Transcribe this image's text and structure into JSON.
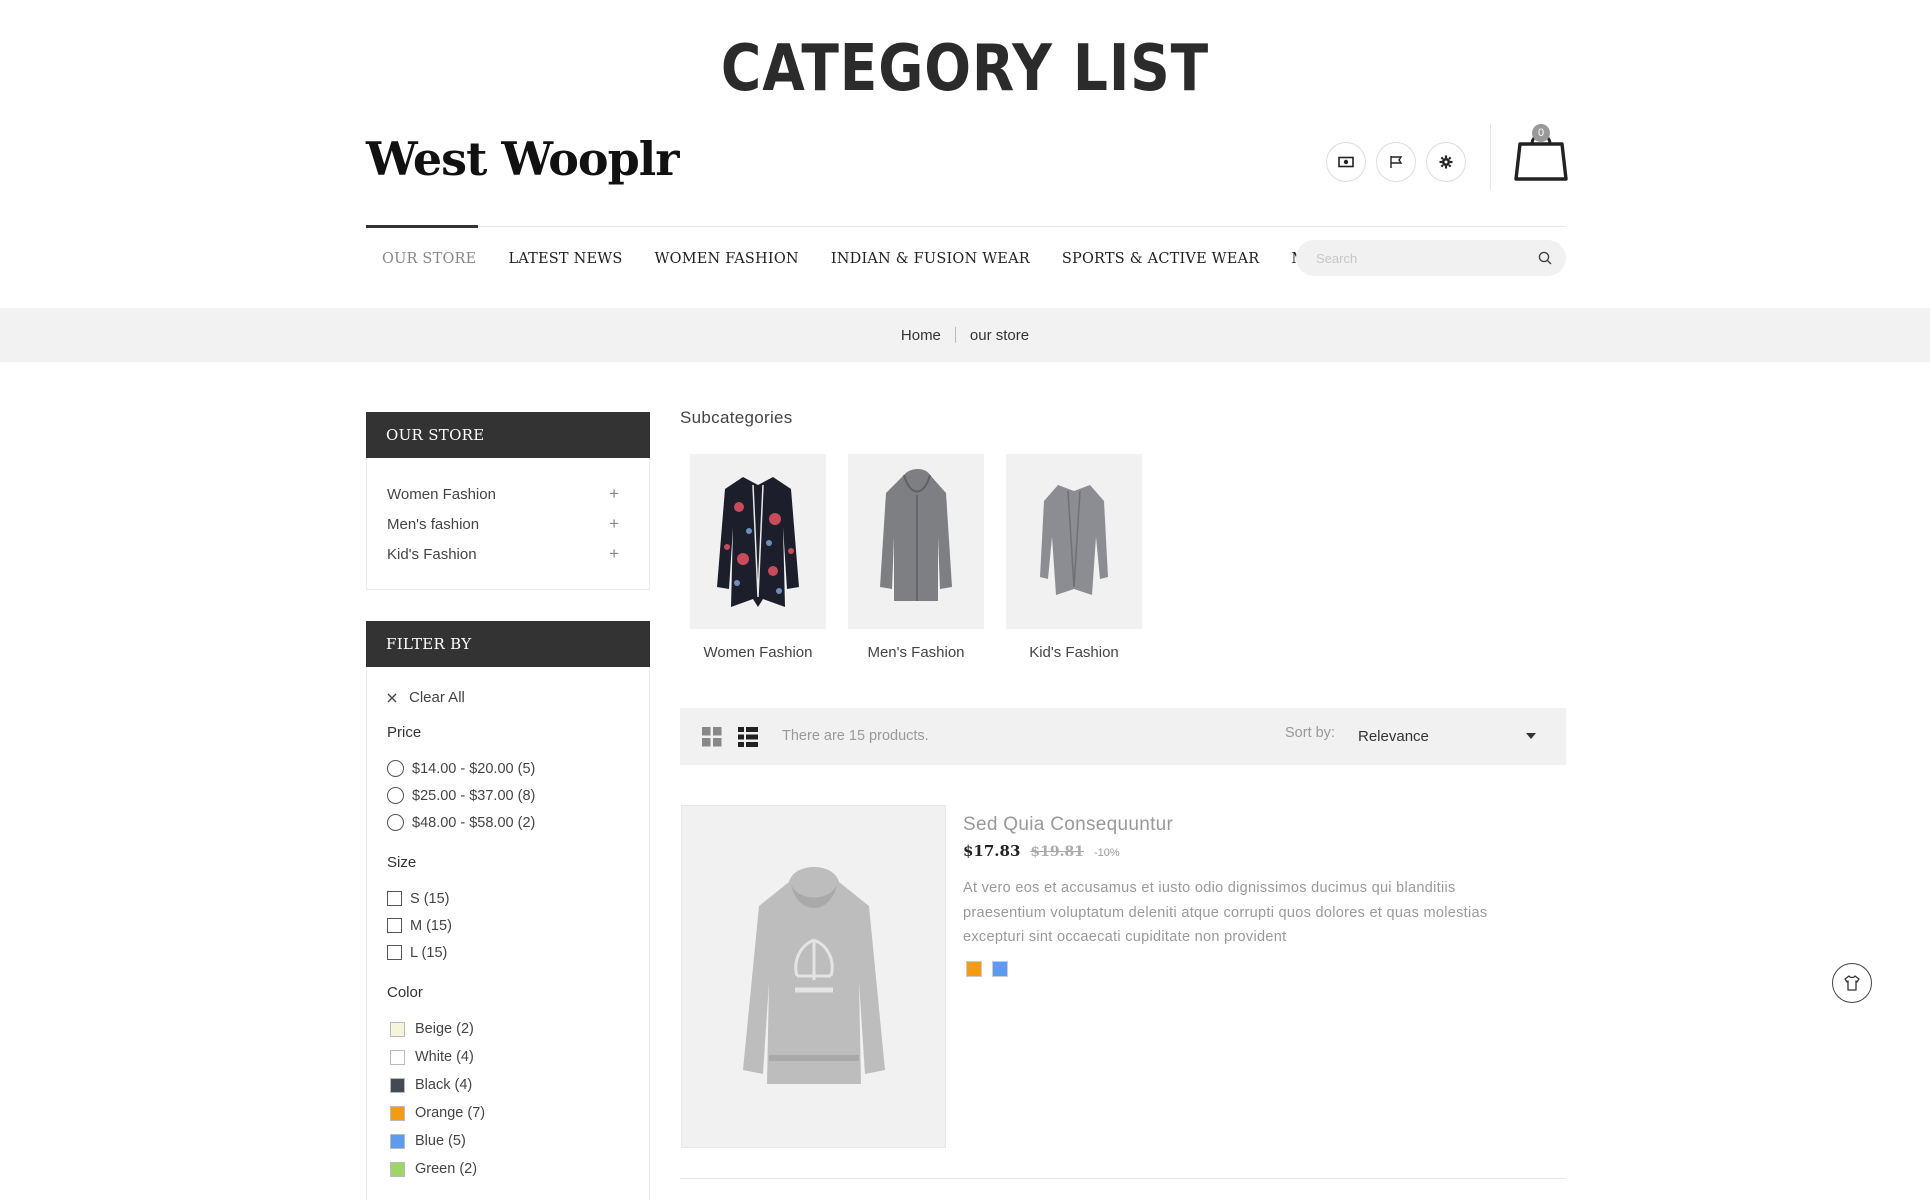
{
  "banner": {
    "title": "CATEGORY LIST"
  },
  "header": {
    "logo": "West Wooplr",
    "cart_count": "0",
    "icons": [
      "currency-icon",
      "language-flag-icon",
      "settings-gear-icon",
      "cart-bag-icon"
    ]
  },
  "nav": {
    "items": [
      {
        "label": "OUR STORE",
        "active": true
      },
      {
        "label": "LATEST NEWS"
      },
      {
        "label": "WOMEN FASHION"
      },
      {
        "label": "INDIAN & FUSION WEAR"
      },
      {
        "label": "SPORTS & ACTIVE WEAR"
      },
      {
        "label": "MORE"
      }
    ],
    "search_placeholder": "Search"
  },
  "breadcrumb": {
    "home": "Home",
    "current": "our store"
  },
  "sidebar": {
    "store_title": "OUR STORE",
    "categories": [
      {
        "label": "Women Fashion"
      },
      {
        "label": "Men's fashion"
      },
      {
        "label": "Kid's Fashion"
      }
    ],
    "filter_title": "FILTER BY",
    "clear_all": "Clear All",
    "price_title": "Price",
    "prices": [
      "$14.00 - $20.00 (5)",
      "$25.00 - $37.00 (8)",
      "$48.00 - $58.00 (2)"
    ],
    "size_title": "Size",
    "sizes": [
      "S (15)",
      "M (15)",
      "L (15)"
    ],
    "color_title": "Color",
    "colors": [
      {
        "label": "Beige (2)",
        "hex": "#f5f5dc"
      },
      {
        "label": "White (4)",
        "hex": "#ffffff"
      },
      {
        "label": "Black (4)",
        "hex": "#434a54"
      },
      {
        "label": "Orange (7)",
        "hex": "#f39c11"
      },
      {
        "label": "Blue (5)",
        "hex": "#5d9cec"
      },
      {
        "label": "Green (2)",
        "hex": "#a0d468"
      }
    ]
  },
  "main": {
    "subcategories_title": "Subcategories",
    "subcategories": [
      {
        "label": "Women Fashion"
      },
      {
        "label": "Men's Fashion"
      },
      {
        "label": "Kid's Fashion"
      }
    ],
    "product_count": "There are 15 products.",
    "sort_label": "Sort by:",
    "sort_value": "Relevance",
    "product": {
      "name": "Sed Quia Consequuntur",
      "price": "$17.83",
      "old_price": "$19.81",
      "discount": "-10%",
      "description": "At vero eos et accusamus et iusto odio dignissimos ducimus qui blanditiis praesentium voluptatum deleniti atque corrupti quos dolores et quas molestias excepturi sint occaecati cupiditate non provident",
      "swatches": [
        "#f39c11",
        "#5d9cec"
      ]
    }
  }
}
